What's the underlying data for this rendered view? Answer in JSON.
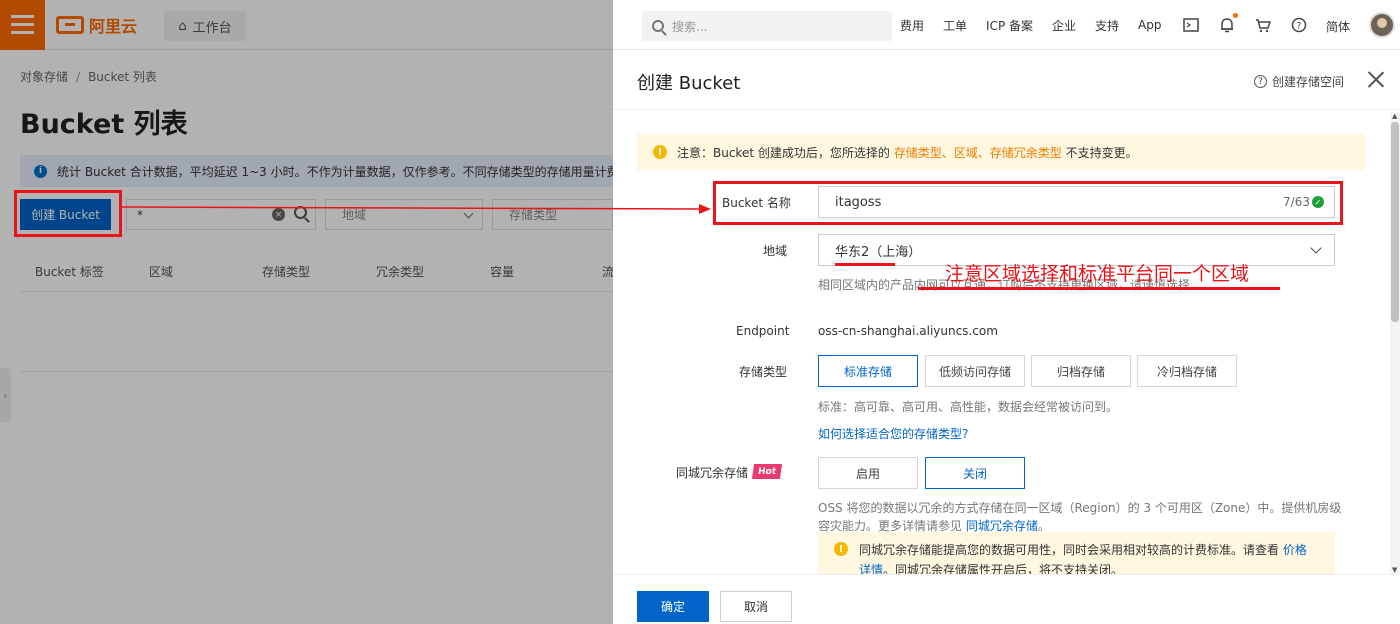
{
  "topbar": {
    "logo_text": "阿里云",
    "workbench_label": "工作台",
    "search_placeholder": "搜索...",
    "links": [
      "费用",
      "工单",
      "ICP 备案",
      "企业",
      "支持",
      "App"
    ],
    "icons": [
      "terminal-icon",
      "bell-icon",
      "cart-icon",
      "help-icon"
    ],
    "lang": "简体",
    "accent": "#ff6a00"
  },
  "page": {
    "breadcrumb": [
      "对象存储",
      "Bucket 列表"
    ],
    "title": "Bucket 列表",
    "notice": "统计 Bucket 合计数据，平均延迟 1~3 小时。不作为计量数据，仅作参考。不同存储类型的存储用量计费方",
    "create_button": "创建 Bucket",
    "filter_value": "*",
    "region_filter": "地域",
    "storage_filter": "存储类型",
    "columns": [
      "Bucket 标签",
      "区域",
      "存储类型",
      "冗余类型",
      "容量",
      "流"
    ]
  },
  "drawer": {
    "title": "创建 Bucket",
    "help_link": "创建存储空间",
    "warning": {
      "prefix": "注意：Bucket 创建成功后，您所选择的 ",
      "h1": "存储类型",
      "sep1": "、",
      "h2": "区域",
      "sep2": "、",
      "h3": "存储冗余类型",
      "suffix": " 不支持变更。"
    },
    "name_label": "Bucket 名称",
    "name_value": "itagoss",
    "name_counter": "7/63",
    "region_label": "地域",
    "region_value": "华东2（上海）",
    "region_help": "相同区域内的产品内网可以互通，订购后不支持更换区域，请谨慎选择",
    "endpoint_label": "Endpoint",
    "endpoint_value": "oss-cn-shanghai.aliyuncs.com",
    "storage_label": "存储类型",
    "storage_options": [
      "标准存储",
      "低频访问存储",
      "归档存储",
      "冷归档存储"
    ],
    "storage_selected": "标准存储",
    "storage_desc": "标准：高可靠、高可用、高性能，数据会经常被访问到。",
    "storage_link": "如何选择适合您的存储类型?",
    "redundancy_label": "同城冗余存储",
    "hot_badge": "Hot",
    "redundancy_options": [
      "启用",
      "关闭"
    ],
    "redundancy_selected": "关闭",
    "redundancy_desc1": "OSS 将您的数据以冗余的方式存储在同一区域（Region）的 3 个可用区（Zone）中。提供机房级",
    "redundancy_desc2_prefix": "容灾能力。更多详情请参见 ",
    "redundancy_desc2_link": "同城冗余存储",
    "redundancy_desc2_suffix": "。",
    "warn2_line1_prefix": "同城冗余存储能提高您的数据可用性，同时会采用相对较高的计费标准。请查看 ",
    "warn2_line1_link": "价格",
    "warn2_line2_link": "详情",
    "warn2_line2_suffix": "。同城冗余存储属性开启后，将不支持关闭。",
    "ok_button": "确定",
    "cancel_button": "取消"
  },
  "annotation": {
    "text": "注意区域选择和标准平台同一个区域",
    "color": "#e8141a"
  }
}
